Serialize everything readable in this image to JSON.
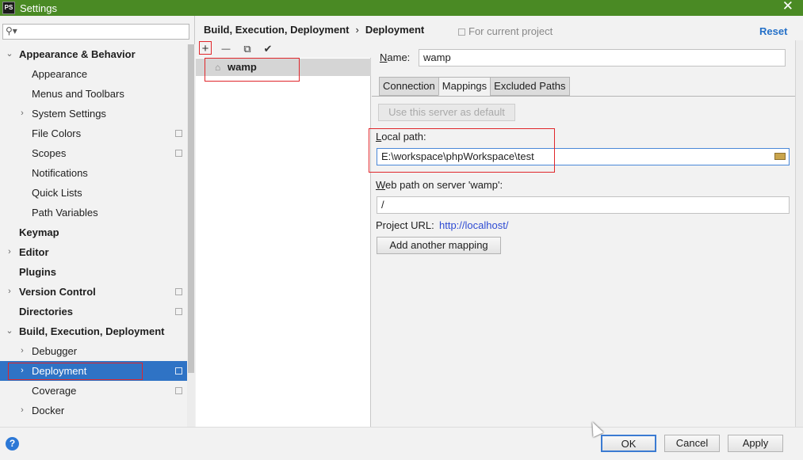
{
  "window": {
    "icon_text": "PS",
    "title": "Settings",
    "close_glyph": "✕"
  },
  "search": {
    "icon": "search-icon",
    "value": ""
  },
  "tree": [
    {
      "label": "Appearance & Behavior",
      "level": 0,
      "expanded": true,
      "bold": true
    },
    {
      "label": "Appearance",
      "level": 1
    },
    {
      "label": "Menus and Toolbars",
      "level": 1
    },
    {
      "label": "System Settings",
      "level": 1,
      "collapsed": true
    },
    {
      "label": "File Colors",
      "level": 1,
      "config_icon": true
    },
    {
      "label": "Scopes",
      "level": 1,
      "config_icon": true
    },
    {
      "label": "Notifications",
      "level": 1
    },
    {
      "label": "Quick Lists",
      "level": 1
    },
    {
      "label": "Path Variables",
      "level": 1
    },
    {
      "label": "Keymap",
      "level": 0,
      "bold": true
    },
    {
      "label": "Editor",
      "level": 0,
      "collapsed": true,
      "bold": true
    },
    {
      "label": "Plugins",
      "level": 0,
      "bold": true
    },
    {
      "label": "Version Control",
      "level": 0,
      "collapsed": true,
      "bold": true,
      "config_icon": true
    },
    {
      "label": "Directories",
      "level": 0,
      "bold": true,
      "config_icon": true
    },
    {
      "label": "Build, Execution, Deployment",
      "level": 0,
      "expanded": true,
      "bold": true
    },
    {
      "label": "Debugger",
      "level": 1,
      "collapsed": true
    },
    {
      "label": "Deployment",
      "level": 1,
      "collapsed": true,
      "selected": true,
      "config_icon": true
    },
    {
      "label": "Coverage",
      "level": 1,
      "config_icon": true
    },
    {
      "label": "Docker",
      "level": 1,
      "collapsed": true
    }
  ],
  "header": {
    "breadcrumb_parent": "Build, Execution, Deployment",
    "breadcrumb_sep": "›",
    "breadcrumb_current": "Deployment",
    "for_project": "For current project",
    "reset": "Reset"
  },
  "servers": {
    "toolbar": {
      "add": "+",
      "remove": "—",
      "copy": "⧉",
      "check": "✔"
    },
    "items": [
      {
        "name": "wamp",
        "icon": "home-icon"
      }
    ]
  },
  "config": {
    "name_label": "Name:",
    "name_value": "wamp",
    "tabs": [
      "Connection",
      "Mappings",
      "Excluded Paths"
    ],
    "active_tab": "Mappings",
    "default_server_btn": "Use this server as default",
    "local_path_label": "Local path:",
    "local_path_value": "E:\\workspace\\phpWorkspace\\test",
    "web_path_label": "Web path on server 'wamp':",
    "web_path_value": "/",
    "project_url_label": "Project URL:",
    "project_url_value": "http://localhost/",
    "add_mapping_btn": "Add another mapping"
  },
  "footer": {
    "help": "?",
    "ok": "OK",
    "cancel": "Cancel",
    "apply": "Apply"
  },
  "colors": {
    "titlebar": "#4a8a24",
    "selection": "#2f73c5",
    "annotation": "#e0262b",
    "link": "#2e4bd3"
  }
}
